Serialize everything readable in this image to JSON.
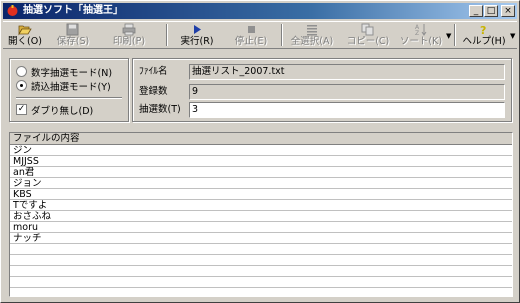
{
  "window": {
    "title": "抽選ソフト「抽選王」",
    "caption_min": "_",
    "caption_max": "□",
    "caption_close": "×"
  },
  "toolbar": {
    "open": "開く(O)",
    "save": "保存(S)",
    "print": "印刷(P)",
    "run": "実行(R)",
    "stop": "停止(E)",
    "select_all": "全選択(A)",
    "copy": "コピー(C)",
    "sort": "ソート(K)",
    "help": "ヘルプ(H)"
  },
  "icons": {
    "open": "folder-open-icon",
    "save": "floppy-disk-icon",
    "print": "printer-icon",
    "run": "play-icon",
    "stop": "stop-icon",
    "select_all": "select-all-icon",
    "copy": "copy-icon",
    "sort": "sort-az-icon",
    "help": "help-question-icon"
  },
  "mode": {
    "numeric": "数字抽選モード(N)",
    "read": "読込抽選モード(Y)",
    "selected": "read",
    "no_duplicates": "ダブり無し(D)",
    "no_duplicates_checked": true
  },
  "file": {
    "name_label": "ﾌｧｲﾙ名",
    "name_value": "抽選リスト_2007.txt",
    "count_label": "登録数",
    "count_value": "9",
    "draw_label": "抽選数(T)",
    "draw_value": "3"
  },
  "content": {
    "header": "ファイルの内容",
    "entries": [
      "ジン",
      "MJJSS",
      "an君",
      "ジョン",
      "KBS",
      "Tですよ",
      "おさふね",
      "moru",
      "ナッチ"
    ]
  },
  "colors": {
    "face": "#d4d0c8",
    "title_start": "#0a246a",
    "title_end": "#a6caf0",
    "run_icon": "#1f3fa8",
    "help_icon": "#c8b400"
  }
}
